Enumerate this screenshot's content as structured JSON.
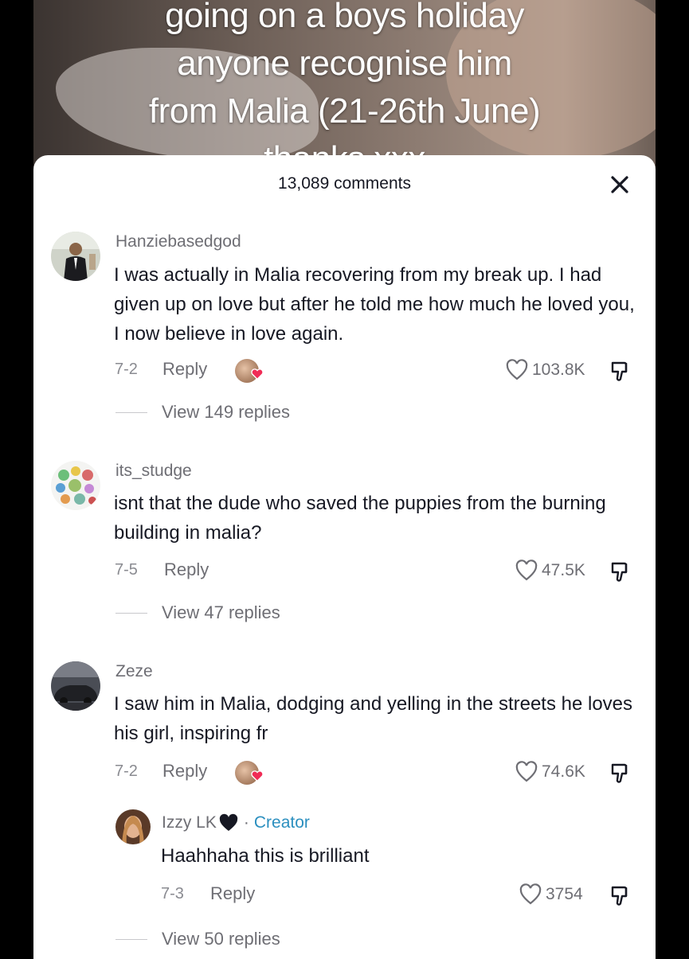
{
  "video": {
    "caption_lines": [
      "going on a boys holiday",
      "anyone recognise him",
      "from Malia (21-26th June)",
      "thanks xxx"
    ]
  },
  "sheet": {
    "comment_count": "13,089 comments"
  },
  "comments": [
    {
      "username": "Hanziebasedgod",
      "text": "I was actually in Malia recovering from my break up. I had given up on love but after he told me how much he loved you, I now believe in love again.",
      "date": "7-2",
      "reply_label": "Reply",
      "likes": "103.8K",
      "view_replies": "View 149 replies",
      "creator_liked": true
    },
    {
      "username": "its_studge",
      "text": "isnt that the dude who saved the puppies from the burning building in malia?",
      "date": "7-5",
      "reply_label": "Reply",
      "likes": "47.5K",
      "view_replies": "View 47 replies",
      "creator_liked": false
    },
    {
      "username": "Zeze",
      "text": "I saw him in Malia, dodging and yelling in the streets he loves his girl, inspiring fr",
      "date": "7-2",
      "reply_label": "Reply",
      "likes": "74.6K",
      "creator_liked": true,
      "view_replies": "View 50 replies",
      "reply": {
        "username": "Izzy LK",
        "creator_label": "Creator",
        "separator": "·",
        "text": "Haahhaha this is brilliant",
        "date": "7-3",
        "reply_label": "Reply",
        "likes": "3754"
      }
    }
  ],
  "colors": {
    "accent_creator": "#2b8fbf",
    "heart_red": "#f02c56",
    "text_primary": "#161823",
    "text_secondary": "#6e6e74"
  }
}
